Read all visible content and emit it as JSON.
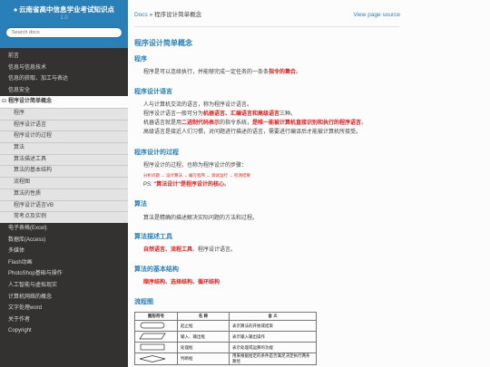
{
  "site": {
    "title": "♠ 云南省高中信息学业考试知识点",
    "version": "1.0"
  },
  "search": {
    "placeholder": "Search docs"
  },
  "nav": {
    "items_before": [
      "前言",
      "信息与信息技术",
      "信息的获取、加工与表达",
      "信息安全"
    ],
    "current": {
      "toggle": "⊟",
      "label": "程序设计简单概念"
    },
    "sub_items": [
      "程序",
      "程序设计语言",
      "程序设计的过程",
      "算法",
      "算法描述工具",
      "算法的基本结构",
      "流程图",
      "算法的性质",
      "程序设计语言VB",
      "常考点及实例"
    ],
    "items_after": [
      "电子表格(Excel)",
      "数据库(Access)",
      "多媒体",
      "Flash动画",
      "PhotoShop基础与操作",
      "人工智能与虚拟现实",
      "计算机网络的概念",
      "文字处理word",
      "关于作者",
      "Copyright"
    ]
  },
  "breadcrumb": {
    "home": "Docs",
    "sep": "»",
    "current": "程序设计简单概念"
  },
  "view_source": "View page source",
  "content": {
    "h1": "程序设计简单概念",
    "s1_h": "程序",
    "s1_p": {
      "pre": "程序是可以连续执行，并能够完成一定任务的一条条",
      "red": "指令的集合",
      "post": "。"
    },
    "s2_h": "程序设计语言",
    "s2_l1": "人与计算机交流的语言，称为程序设计语言。",
    "s2_l2": {
      "pre": "程序设计语言一般可分为",
      "red": "机器语言、汇编语言和高级语言",
      "post": "三种。"
    },
    "s2_l3": {
      "pre": "机器语言就是用",
      "red1": "二进制代码表示",
      "mid": "的指令系统，",
      "red2": "是唯一能被计算机直接识别和执行的程序语言",
      "post": "。"
    },
    "s2_l4": "高级语言是接近人们习惯，对问题进行描述的语言，需要进行编译后才能被计算机所接受。",
    "s3_h": "程序设计的过程",
    "s3_p": "程序设计的过程，也称为程序设计的步骤：",
    "s3_steps": "分析问题 → 设计算法 → 编写程序 → 调试运行 → 检测结果",
    "s3_ps": {
      "pre": "PS: ",
      "red": "\"算法设计\"是程序设计的核心",
      "post": "。"
    },
    "s4_h": "算法",
    "s4_p": "算法是精确的描述解决实际问题的方法和过程。",
    "s5_h": "算法描述工具",
    "s5_p": {
      "red": "自然语言、流程工具",
      "post": "、程序设计语言。"
    },
    "s6_h": "算法的基本结构",
    "s6_p": "顺序结构、选择结构、循环结构",
    "s7_h": "流程图",
    "table": {
      "headers": [
        "图形符号",
        "名  称",
        "含  义"
      ],
      "rows": [
        [
          "",
          "起止框",
          "表示算法的开始或结束"
        ],
        [
          "",
          "输入、输出框",
          "表示输入输出操作"
        ],
        [
          "",
          "处理框",
          "表示处理或运算的功能"
        ],
        [
          "",
          "判断框",
          "用来根据给定的条件是否满足决定执行两条路径"
        ]
      ]
    }
  }
}
